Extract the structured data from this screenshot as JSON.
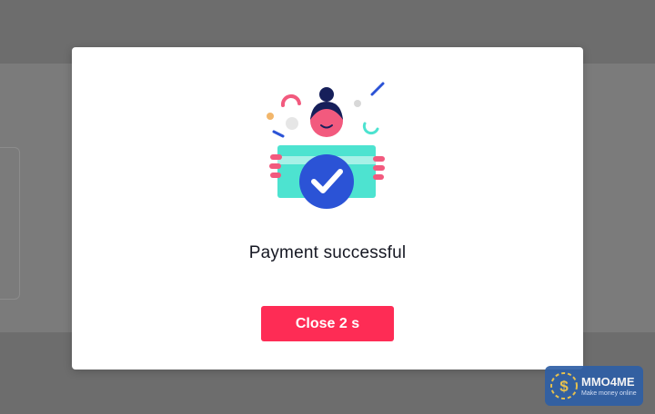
{
  "modal": {
    "title": "Payment successful",
    "close_button_label": "Close 2 s"
  },
  "watermark": {
    "name": "MMO4ME",
    "tagline": "Make money online"
  },
  "colors": {
    "accent": "#fe2c55",
    "card": "#4de3d0",
    "check_badge": "#2b53d6",
    "skin": "#f25a7e",
    "hair": "#161f5a"
  },
  "icons": {
    "illustration": "payment-success-illustration",
    "check": "checkmark-icon"
  }
}
